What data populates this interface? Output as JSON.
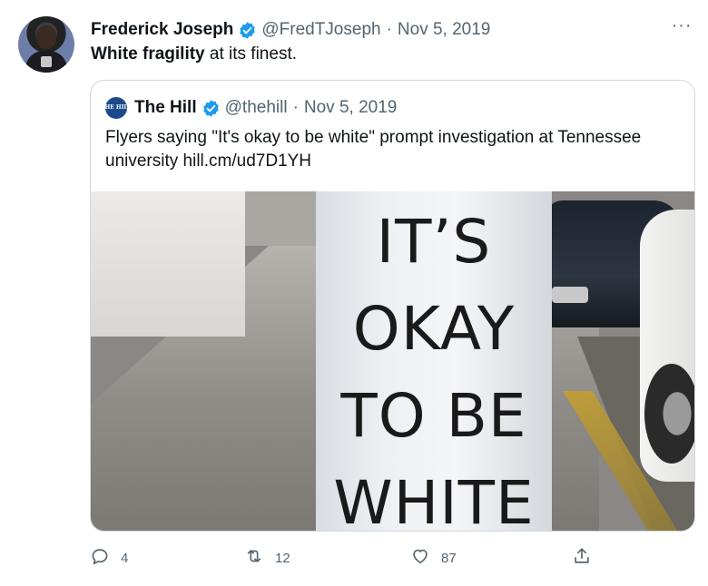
{
  "tweet": {
    "author_name": "Frederick Joseph",
    "author_handle": "@FredTJoseph",
    "separator": "·",
    "date": "Nov 5, 2019",
    "text_bold": "White fragility",
    "text_rest": " at its finest.",
    "more_label": "···"
  },
  "quoted": {
    "logo_text": "THE HILL",
    "author_name": "The Hill",
    "author_handle": "@thehill",
    "separator": "·",
    "date": "Nov 5, 2019",
    "text": "Flyers saying \"It's okay to be white\" prompt investigation at Tennessee university hill.cm/ud7D1YH",
    "image": {
      "sign_line1": "IT’S",
      "sign_line2": "OKAY",
      "sign_line3": "TO BE",
      "sign_line4": "WHITE"
    }
  },
  "actions": {
    "reply_count": "4",
    "retweet_count": "12",
    "like_count": "87",
    "share_icon": "share-icon"
  },
  "colors": {
    "verified": "#1d9bf0",
    "secondary_text": "#536471",
    "border": "#cfd9de"
  }
}
